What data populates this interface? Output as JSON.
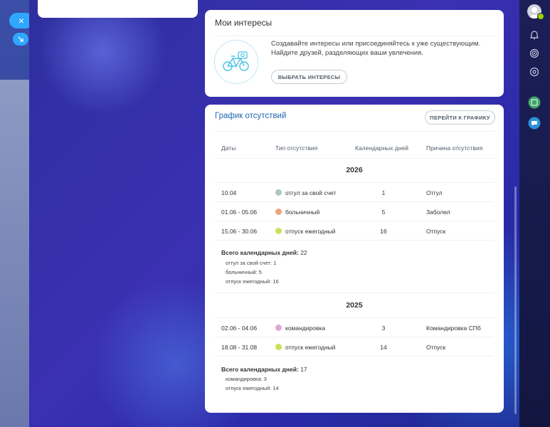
{
  "interests": {
    "title": "Мои интересы",
    "description": "Создавайте интересы или присоединяйтесь к уже существующим. Найдите друзей, разделяющих ваши увлечения.",
    "button_label": "ВЫБРАТЬ ИНТЕРЕСЫ"
  },
  "absence": {
    "title": "График отсутствий",
    "goto_button": "ПЕРЕЙТИ К ГРАФИКУ",
    "columns": [
      "Даты",
      "Тип отсутствия",
      "Календарных дней",
      "Причина отсутствия"
    ],
    "total_label": "Всего календарных дней:",
    "years": [
      {
        "year": "2026",
        "rows": [
          {
            "dates": "10.04",
            "type": "отгул за свой счет",
            "color": "#a8c7c2",
            "days": "1",
            "reason": "Отгул"
          },
          {
            "dates": "01.06 - 05.06",
            "type": "больничный",
            "color": "#f0a37a",
            "days": "5",
            "reason": "Заболел"
          },
          {
            "dates": "15.06 - 30.06",
            "type": "отпуск ежегодный",
            "color": "#c8e25a",
            "days": "16",
            "reason": "Отпуск"
          }
        ],
        "total": "22",
        "breakdown": [
          "отгул за свой счет: 1",
          "больничный: 5",
          "отпуск ежегодный: 16"
        ]
      },
      {
        "year": "2025",
        "rows": [
          {
            "dates": "02.06 - 04.06",
            "type": "командировка",
            "color": "#e0a8d8",
            "days": "3",
            "reason": "Командировка СПб"
          },
          {
            "dates": "18.08 - 31.08",
            "type": "отпуск ежегодный",
            "color": "#c8e25a",
            "days": "14",
            "reason": "Отпуск"
          }
        ],
        "total": "17",
        "breakdown": [
          "командировка: 3",
          "отпуск ежегодный: 14"
        ]
      }
    ]
  },
  "close_icon": "×",
  "colors": {
    "accent": "#2fa7ff",
    "title_blue": "#2067b0",
    "online": "#9bd000"
  }
}
